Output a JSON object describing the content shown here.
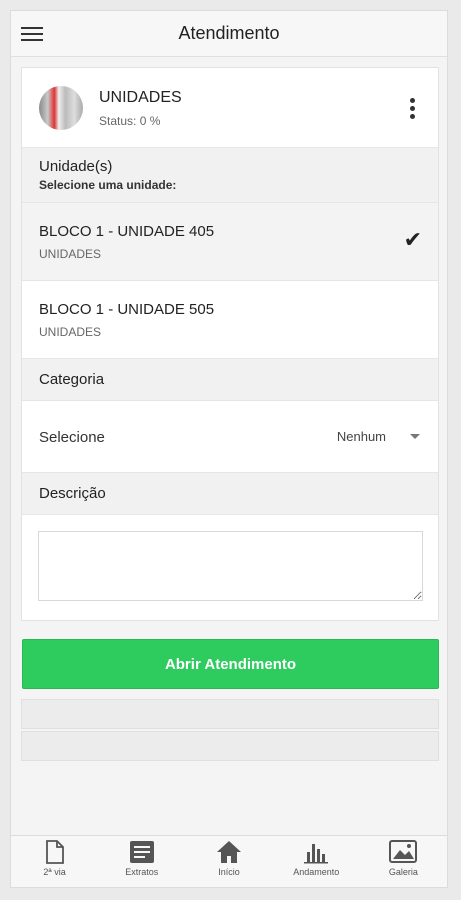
{
  "header": {
    "title": "Atendimento"
  },
  "unit": {
    "name": "UNIDADES",
    "status": "Status: 0 %"
  },
  "units_section": {
    "heading": "Unidade(s)",
    "subheading": "Selecione uma unidade:",
    "items": [
      {
        "label": "BLOCO 1 - UNIDADE 405",
        "sub": "UNIDADES",
        "selected": true
      },
      {
        "label": "BLOCO 1 - UNIDADE 505",
        "sub": "UNIDADES",
        "selected": false
      }
    ]
  },
  "category_section": {
    "heading": "Categoria",
    "select_label": "Selecione",
    "select_value": "Nenhum"
  },
  "description_section": {
    "heading": "Descrição",
    "value": ""
  },
  "actions": {
    "open_label": "Abrir Atendimento"
  },
  "colors": {
    "accent": "#2ecc5f"
  },
  "bottom_nav": [
    {
      "label": "2ª via",
      "icon": "document-icon"
    },
    {
      "label": "Extratos",
      "icon": "statement-icon"
    },
    {
      "label": "Início",
      "icon": "home-icon"
    },
    {
      "label": "Andamento",
      "icon": "bar-chart-icon"
    },
    {
      "label": "Galeria",
      "icon": "gallery-icon"
    }
  ]
}
